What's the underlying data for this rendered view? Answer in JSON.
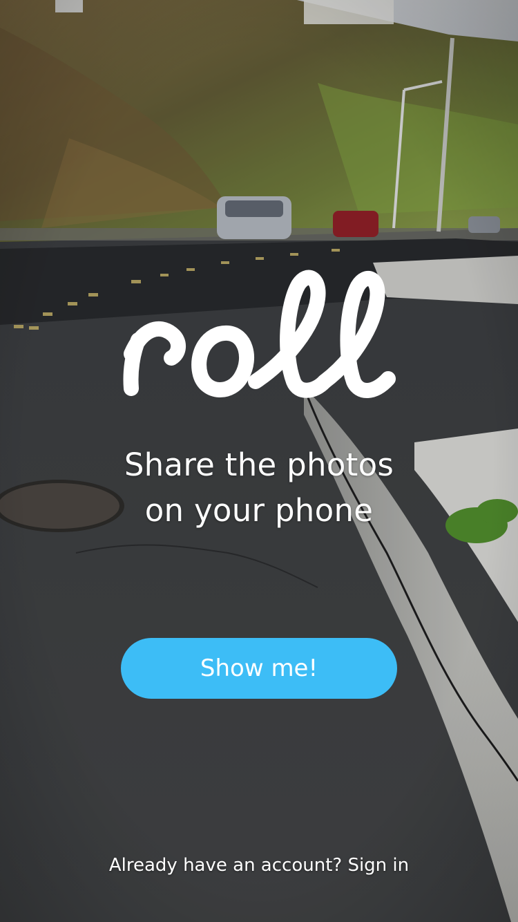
{
  "app": {
    "logo_text": "roll"
  },
  "tagline": {
    "line1": "Share the photos",
    "line2": "on your phone"
  },
  "cta": {
    "label": "Show me!"
  },
  "footer": {
    "signin_text": "Already have an account? Sign in"
  },
  "colors": {
    "accent": "#3dbdf6",
    "text": "#ffffff"
  }
}
